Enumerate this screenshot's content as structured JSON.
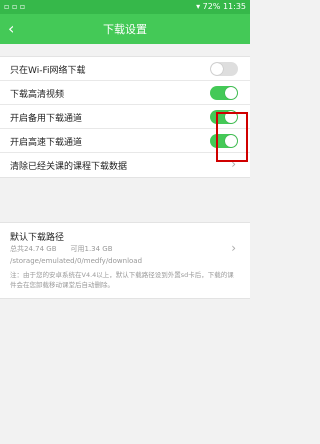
{
  "status_bar": {
    "left_icons": "▫ ▫ ▫",
    "right": "▾ 72% 11:35"
  },
  "header": {
    "back_icon": "‹",
    "title": "下载设置"
  },
  "settings": [
    {
      "label": "只在Wi-Fi网络下载",
      "state": "off"
    },
    {
      "label": "下载高清视频",
      "state": "on"
    },
    {
      "label": "开启备用下载通道",
      "state": "on"
    },
    {
      "label": "开启高速下载通道",
      "state": "on"
    },
    {
      "label": "清除已经关课的课程下载数据",
      "chevron": "›"
    }
  ],
  "download_path": {
    "title": "默认下载路径",
    "total": "总共24.74 GB",
    "available": "可用1.34 GB",
    "path": "/storage/emulated/0/medfy/download",
    "note": "注：由于您的安卓系统在V4.4以上，默认下载路径设到外置sd卡后，下载的课件会在您卸载移动课堂后自动删除。",
    "chevron": "›"
  },
  "colors": {
    "accent": "#44c957",
    "status_bar": "#36b84a",
    "highlight": "#d00000"
  }
}
